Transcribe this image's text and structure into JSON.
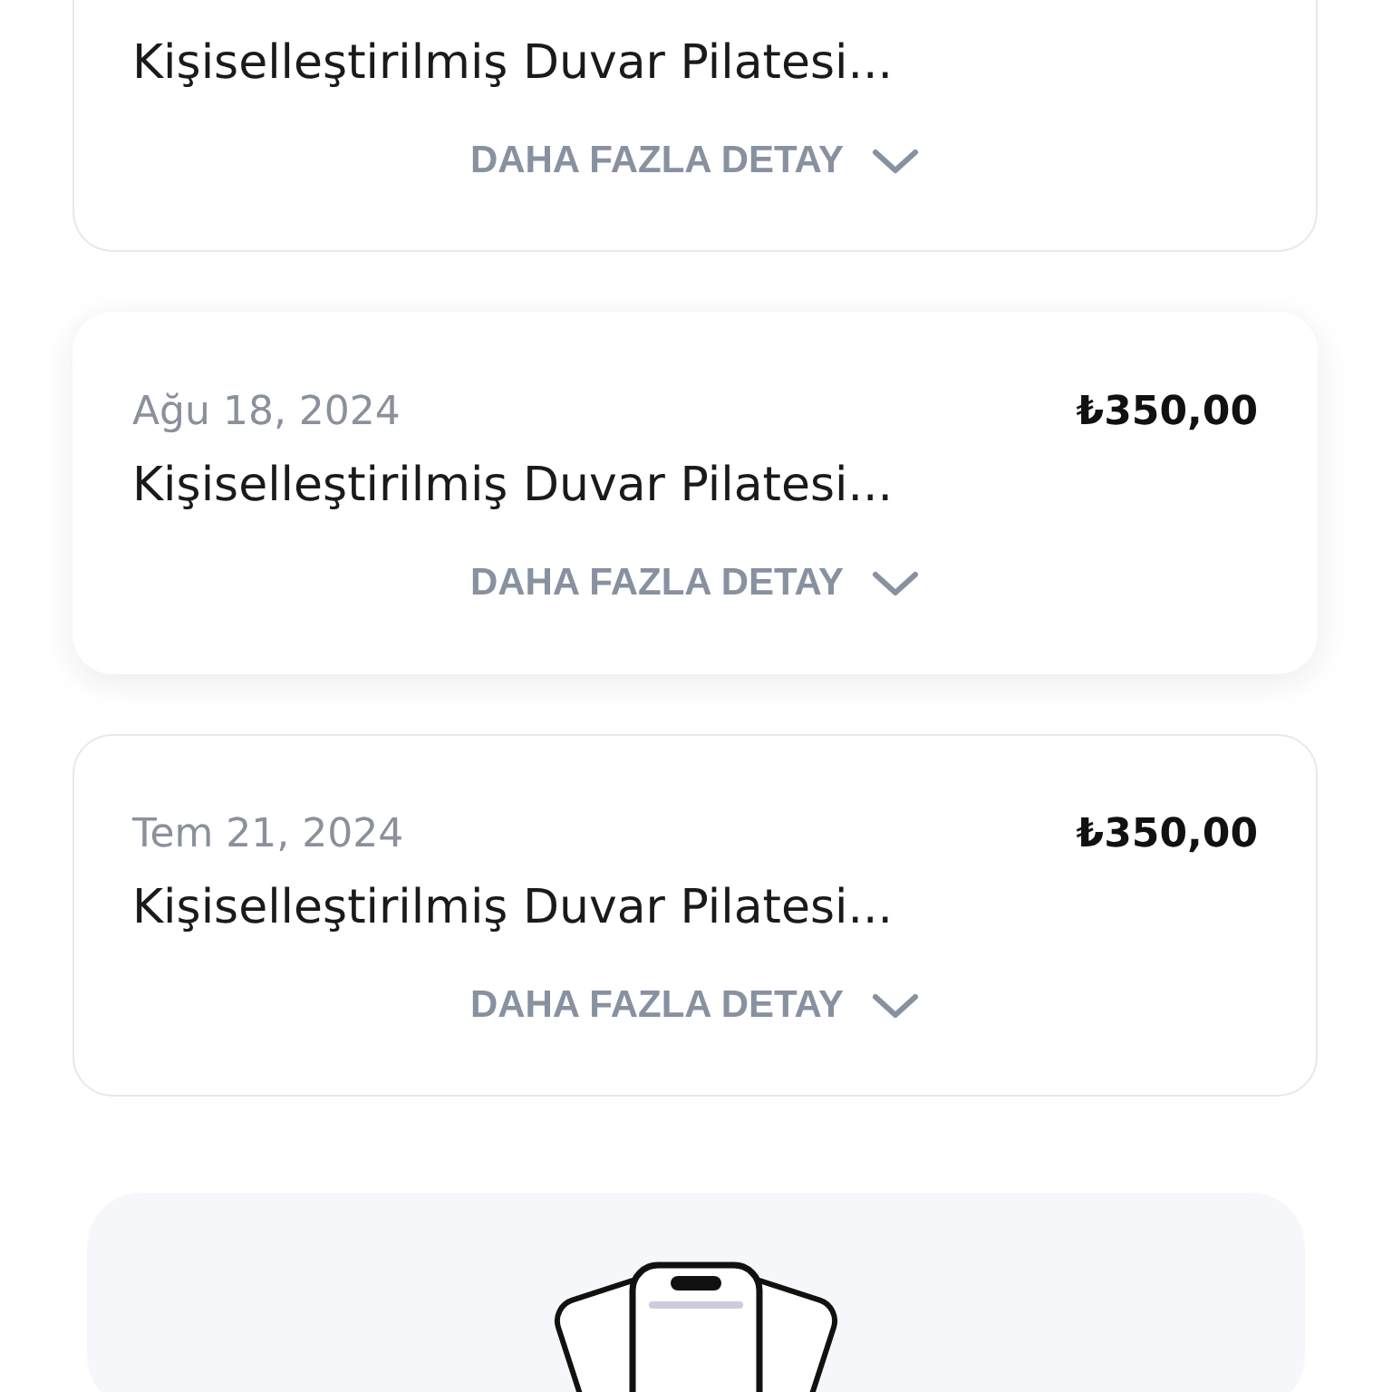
{
  "purchases": [
    {
      "title": "Kişiselleştirilmiş Duvar Pilatesi...",
      "details_label": "DAHA FAZLA DETAY",
      "elevated": false
    },
    {
      "date": "Ağu 18, 2024",
      "price": "₺350,00",
      "title": "Kişiselleştirilmiş Duvar Pilatesi...",
      "details_label": "DAHA FAZLA DETAY",
      "elevated": true
    },
    {
      "date": "Tem 21, 2024",
      "price": "₺350,00",
      "title": "Kişiselleştirilmiş Duvar Pilatesi...",
      "details_label": "DAHA FAZLA DETAY",
      "elevated": false
    }
  ]
}
